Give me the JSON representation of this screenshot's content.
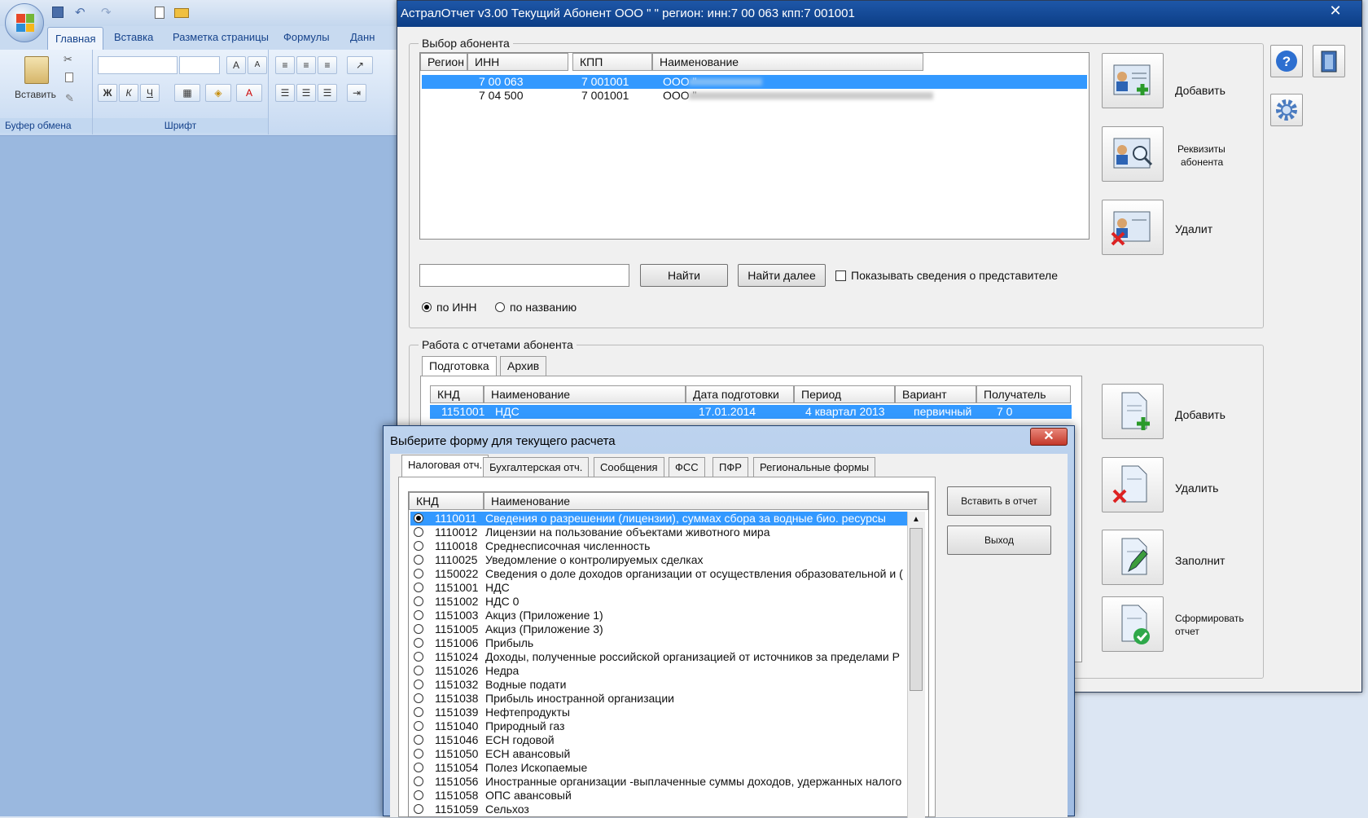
{
  "excel": {
    "tabs": [
      "Главная",
      "Вставка",
      "Разметка страницы",
      "Формулы",
      "Данн"
    ],
    "paste_label": "Вставить",
    "clipboard_group": "Буфер обмена",
    "font_group": "Шрифт",
    "font_buttons": [
      "Ж",
      "К",
      "Ч"
    ]
  },
  "window": {
    "title": "АстралОтчет v3.00 Текущий Абонент ООО \"          \" регион:   инн:7   00   063 кпп:7    001001",
    "close_label": "✕"
  },
  "subscriber": {
    "legend": "Выбор абонента",
    "columns": [
      "Регион",
      "ИНН",
      "КПП",
      "Наименование"
    ],
    "rows": [
      {
        "region": "",
        "inn": "7   00   063",
        "kpp": "7    001001",
        "name": "ООО \""
      },
      {
        "region": "",
        "inn": "7   04   500",
        "kpp": "7    001001",
        "name": "ООО \""
      }
    ],
    "search_value": "",
    "find_label": "Найти",
    "find_next_label": "Найти далее",
    "show_rep_label": "Показывать сведения о представителе",
    "radio_inn": "по ИНН",
    "radio_name": "по названию",
    "add_label": "Добавить",
    "details_label_1": "Реквизиты",
    "details_label_2": "абонента",
    "delete_label": "Удалит"
  },
  "reports": {
    "legend": "Работа с отчетами абонента",
    "tabs": [
      "Подготовка",
      "Архив"
    ],
    "columns": [
      "КНД",
      "Наименование",
      "Дата подготовки",
      "Период",
      "Вариант",
      "Получатель"
    ],
    "row": {
      "knd": "1151001",
      "name": "НДС",
      "date": "17.01.2014",
      "period": "4 квартал 2013",
      "variant": "первичный",
      "recipient": "7    0"
    },
    "add_label": "Добавить",
    "delete_label": "Удалить",
    "fill_label": "Заполнит",
    "form_label_1": "Сформировать",
    "form_label_2": "отчет"
  },
  "dialog": {
    "title": "Выберите форму для текущего расчета",
    "close_label": "✕",
    "tabs": [
      "Налоговая отч.",
      "Бухгалтерская отч.",
      "Сообщения",
      "ФСС",
      "ПФР",
      "Региональные формы"
    ],
    "columns": [
      "КНД",
      "Наименование"
    ],
    "insert_label": "Вставить в отчет",
    "exit_label": "Выход",
    "forms": [
      {
        "knd": "1110011",
        "name": "Сведения о разрешении (лицензии), суммах сбора за водные био. ресурсы",
        "selected": true
      },
      {
        "knd": "1110012",
        "name": "Лицензии на пользование объектами животного мира"
      },
      {
        "knd": "1110018",
        "name": "Среднесписочная численность"
      },
      {
        "knd": "1110025",
        "name": "Уведомление о контролируемых сделках"
      },
      {
        "knd": "1150022",
        "name": "Сведения о доле доходов организации от осуществления образовательной и ("
      },
      {
        "knd": "1151001",
        "name": "НДС"
      },
      {
        "knd": "1151002",
        "name": "НДС 0"
      },
      {
        "knd": "1151003",
        "name": "Акциз (Приложение 1)"
      },
      {
        "knd": "1151005",
        "name": "Акциз (Приложение 3)"
      },
      {
        "knd": "1151006",
        "name": "Прибыль"
      },
      {
        "knd": "1151024",
        "name": "Доходы, полученные российской организацией от источников за пределами Р"
      },
      {
        "knd": "1151026",
        "name": "Недра"
      },
      {
        "knd": "1151032",
        "name": "Водные подати"
      },
      {
        "knd": "1151038",
        "name": "Прибыль иностранной организации"
      },
      {
        "knd": "1151039",
        "name": "Нефтепродукты"
      },
      {
        "knd": "1151040",
        "name": "Природный газ"
      },
      {
        "knd": "1151046",
        "name": "ЕСН годовой"
      },
      {
        "knd": "1151050",
        "name": "ЕСН авансовый"
      },
      {
        "knd": "1151054",
        "name": "Полез Ископаемые"
      },
      {
        "knd": "1151056",
        "name": "Иностранные организации -выплаченные суммы доходов, удержанных налого"
      },
      {
        "knd": "1151058",
        "name": "ОПС авансовый"
      },
      {
        "knd": "1151059",
        "name": "Сельхоз"
      }
    ]
  }
}
